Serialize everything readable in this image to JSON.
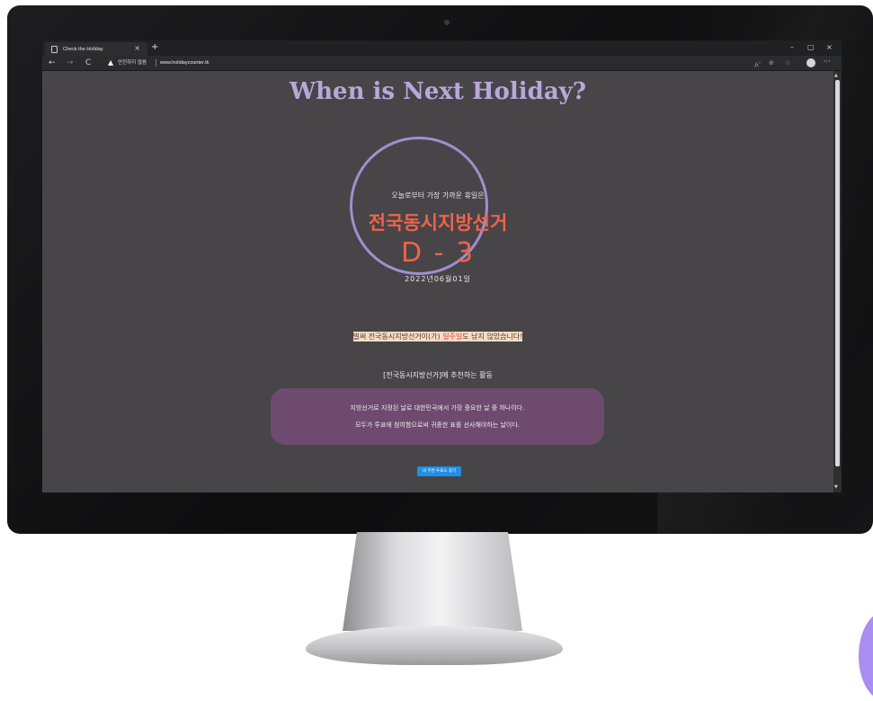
{
  "browser": {
    "tab_title": "Check the Holiday",
    "tab_close": "×",
    "new_tab": "+",
    "window_minimize": "–",
    "window_restore": "▢",
    "window_close": "×",
    "nav": {
      "back": "←",
      "forward": "→",
      "reload": "C"
    },
    "security_warning": "안전하지 않음",
    "url": "www.holidaycounter.tk",
    "more": "···",
    "toolbar_icons": [
      "read-aloud-icon",
      "zoom-icon",
      "favorites-icon"
    ]
  },
  "page": {
    "headline": "When is Next Holiday?",
    "closest_label": "오늘로부터 가장 가까운 휴일은",
    "holiday_name": "전국동시지방선거",
    "dday": "D - 3",
    "date": "2022년06월01일",
    "notice_pre": "벌써 전국동시지방선거이(가) ",
    "notice_emph": "일주일",
    "notice_post": "도 남지 않았습니다!",
    "recommend_title": "[전국동시지방선거]에 추천하는 활동",
    "recommend_lines": [
      "지방선거로 지정된 날로 대한민국에서 가장 중요한 날 중 하나이다.",
      "모두가 투표에 참여함으로써 귀중한 표를 선사해야하는 날이다."
    ],
    "find_button": "내 주변 투표소 찾기"
  },
  "colors": {
    "headline": "#b9a7da",
    "ring": "#9e8fd0",
    "holiday": "#f0624a",
    "highlight_bg": "#f4ddc6",
    "reco_box": "#6e4a6f",
    "button": "#1e90e8"
  }
}
